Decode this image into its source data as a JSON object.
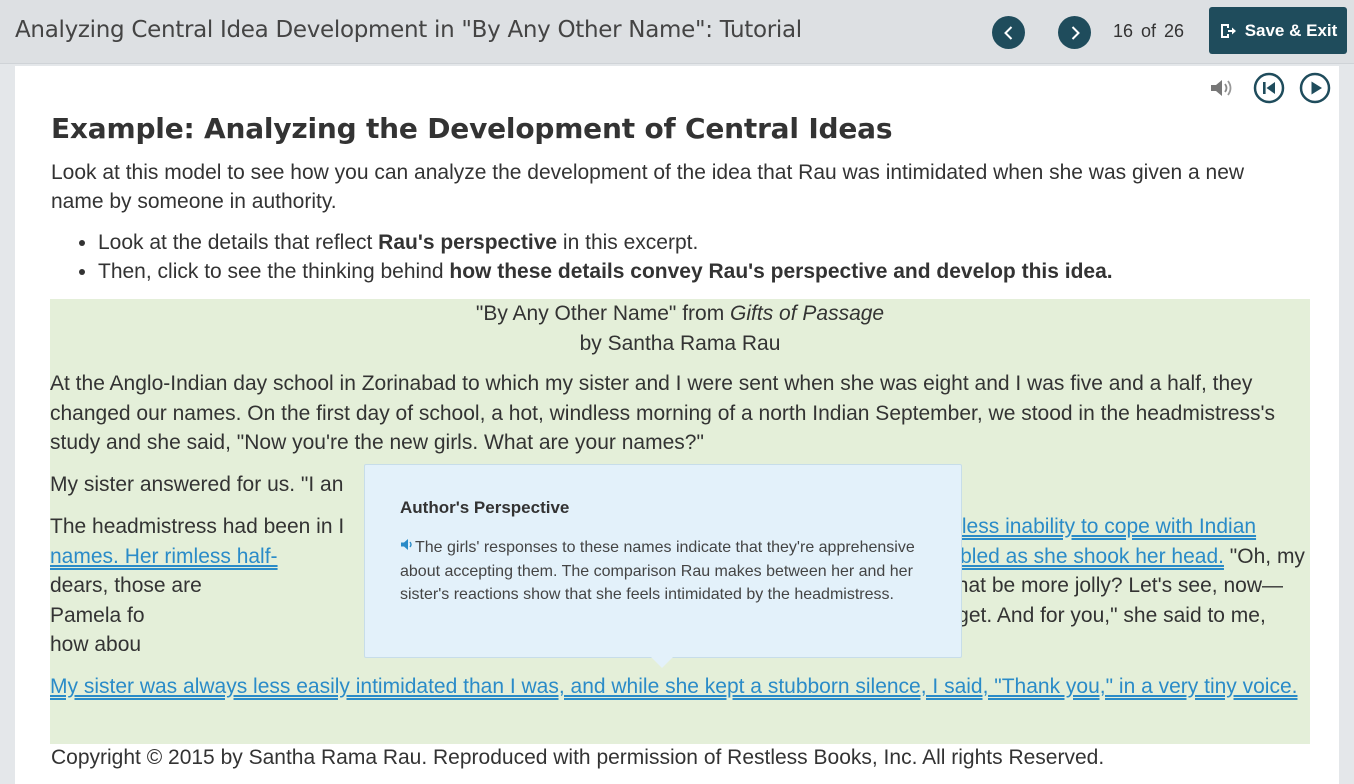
{
  "header": {
    "title": "Analyzing Central Idea Development in \"By Any Other Name\": Tutorial",
    "page_current": "16",
    "page_of": "of",
    "page_total": "26",
    "save_exit_label": "Save & Exit"
  },
  "media_controls": [
    "speaker-icon",
    "restart-icon",
    "play-icon"
  ],
  "main": {
    "heading": "Example: Analyzing the Development of Central Ideas",
    "intro": "Look at this model to see how you can analyze the development of the idea that Rau was intimidated when she was given a new name by someone in authority.",
    "bullets": [
      {
        "pre": "Look at the details that reflect ",
        "bold": "Rau's perspective",
        "post": " in this excerpt."
      },
      {
        "pre": "Then, click to see the thinking behind ",
        "bold": "how these details convey Rau's perspective and develop this idea.",
        "post": ""
      }
    ]
  },
  "excerpt": {
    "title_pre": "\"By Any Other Name\" from ",
    "title_italic": "Gifts of Passage",
    "byline": "by Santha Rama Rau",
    "p1": "At the Anglo-Indian day school in Zorinabad to which my sister and I were sent when she was eight and I was five and a half, they changed our names. On the first day of school, a hot, windless morning of a north Indian September, we stood in the headmistress's study and she said, \"Now you're the new girls. What are your names?\"",
    "p2": "My sister answered for us. \"I an",
    "p3_a": "The headmistress had been in I",
    "p3_link1": "helpless inability to cope with Indian names. Her rimless half-",
    "p3_link2": "head trembled as she shook her head.",
    "p3_b": " \"Oh, my dears, those are",
    "p3_c": "names. Wouldn't that be more jolly? Let's see, now—Pamela fo",
    "p3_d": "That's as close as I can get. And for you,\" she said to me, how abou",
    "p4_link": "My sister was always less easily intimidated than I was, and while she kept a stubborn silence, I said, \"Thank you,\" in a very tiny voice."
  },
  "copyright": "Copyright © 2015 by Santha Rama Rau. Reproduced with permission of Restless Books, Inc. All rights Reserved.",
  "popup": {
    "title": "Author's Perspective",
    "body": "The girls' responses to these names indicate that they're apprehensive about accepting them. The comparison Rau makes between her and her sister's reactions show that she feels intimidated by the headmistress."
  },
  "colors": {
    "accent": "#1f4c5c",
    "excerpt_bg": "#e4efd9",
    "link": "#2a8bc8",
    "popup_bg": "#e3f1fa"
  }
}
